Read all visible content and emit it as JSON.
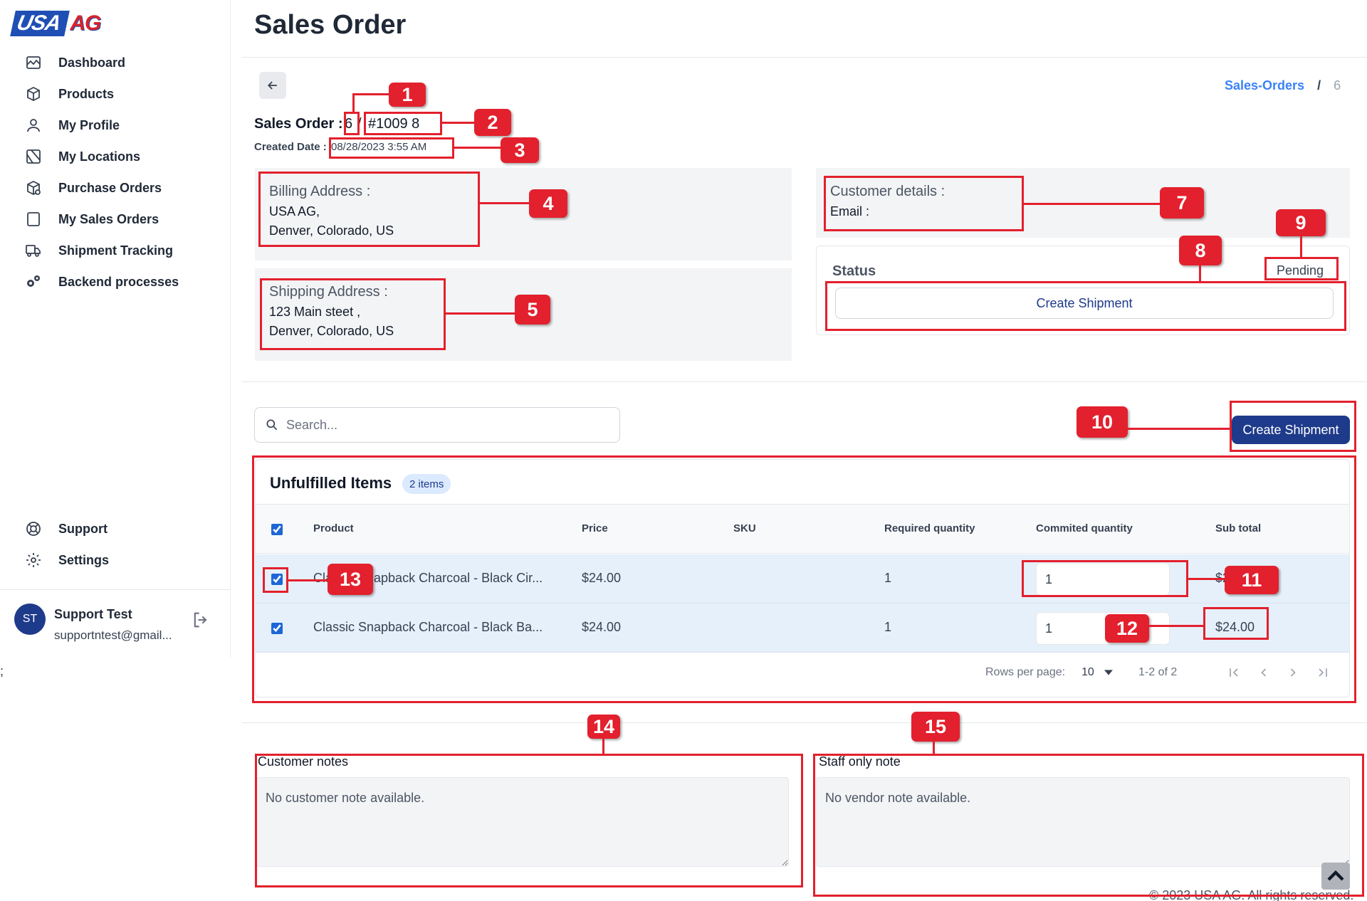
{
  "brand": {
    "logo_usa": "USA",
    "logo_ag": "AG"
  },
  "sidebar": {
    "items": [
      {
        "label": "Dashboard",
        "icon": "chart-icon"
      },
      {
        "label": "Products",
        "icon": "box-icon"
      },
      {
        "label": "My Profile",
        "icon": "user-icon"
      },
      {
        "label": "My Locations",
        "icon": "map-icon"
      },
      {
        "label": "Purchase Orders",
        "icon": "package-icon"
      },
      {
        "label": "My Sales Orders",
        "icon": "order-icon"
      },
      {
        "label": "Shipment Tracking",
        "icon": "truck-icon"
      },
      {
        "label": "Backend processes",
        "icon": "gears-icon"
      }
    ],
    "bottom_items": [
      {
        "label": "Support",
        "icon": "lifebuoy-icon"
      },
      {
        "label": "Settings",
        "icon": "gear-icon"
      }
    ],
    "user": {
      "initials": "ST",
      "name": "Support Test",
      "email": "supportntest@gmail..."
    },
    "stray_text": ";"
  },
  "page": {
    "title": "Sales Order",
    "breadcrumb": {
      "link": "Sales-Orders",
      "separator": "/",
      "current": "6"
    },
    "order": {
      "label": "Sales Order :",
      "id": "6",
      "separator": "/",
      "number": "#1009 8",
      "created_label": "Created Date :",
      "created_value": "08/28/2023 3:55 AM"
    },
    "billing": {
      "heading": "Billing Address :",
      "line1": "USA AG,",
      "line2": "Denver, Colorado, US"
    },
    "shipping": {
      "heading": "Shipping Address :",
      "line1": "123 Main steet ,",
      "line2": "Denver, Colorado, US"
    },
    "customer": {
      "heading": "Customer details :",
      "email_label": "Email :"
    },
    "status": {
      "label": "Status",
      "value": "Pending",
      "button": "Create Shipment"
    },
    "search": {
      "placeholder": "Search..."
    },
    "create_shipment_button": "Create Shipment",
    "table": {
      "title": "Unfulfilled Items",
      "badge": "2 items",
      "columns": [
        "Product",
        "Price",
        "SKU",
        "Required quantity",
        "Commited quantity",
        "Sub total"
      ],
      "rows": [
        {
          "checked": true,
          "product": "Classic Snapback Charcoal - Black Cir...",
          "price": "$24.00",
          "sku": "",
          "required": "1",
          "committed": "1",
          "subtotal": "$24.00"
        },
        {
          "checked": true,
          "product": "Classic Snapback Charcoal - Black Ba...",
          "price": "$24.00",
          "sku": "",
          "required": "1",
          "committed": "1",
          "subtotal": "$24.00"
        }
      ],
      "pagination": {
        "rows_per_page_label": "Rows per page:",
        "rows_per_page": "10",
        "range": "1-2 of 2"
      }
    },
    "notes": {
      "customer_label": "Customer notes",
      "customer_text": "No customer note available.",
      "staff_label": "Staff only note",
      "staff_text": "No vendor note available."
    },
    "footer": "© 2023 USA AG. All rights reserved."
  },
  "annotations": {
    "color": "#e3202d",
    "labels": [
      "1",
      "2",
      "3",
      "4",
      "5",
      "7",
      "8",
      "9",
      "10",
      "11",
      "12",
      "13",
      "14",
      "15"
    ]
  }
}
